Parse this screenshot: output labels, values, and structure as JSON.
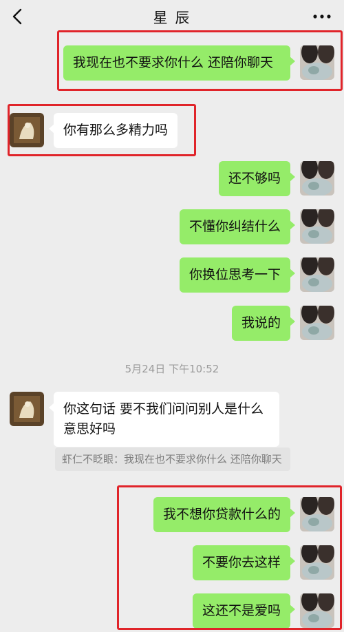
{
  "header": {
    "title": "星 辰",
    "back_icon": "chevron-left-icon",
    "more_icon": "more-dots-icon"
  },
  "messages": [
    {
      "side": "me",
      "text": "我现在也不要求你什么 还陪你聊天"
    },
    {
      "side": "other",
      "text": "你有那么多精力吗"
    },
    {
      "side": "me",
      "text": "还不够吗"
    },
    {
      "side": "me",
      "text": "不懂你纠结什么"
    },
    {
      "side": "me",
      "text": "你换位思考一下"
    },
    {
      "side": "me",
      "text": "我说的"
    },
    {
      "side": "other",
      "text": "你这句话 要不我们问问别人是什么意思好吗"
    },
    {
      "side": "me",
      "text": "我不想你贷款什么的"
    },
    {
      "side": "me",
      "text": "不要你去这样"
    },
    {
      "side": "me",
      "text": "这还不是爱吗"
    }
  ],
  "timestamp": "5月24日 下午10:52",
  "quote": "虾仁不眨眼：我现在也不要求你什么 还陪你聊天",
  "colors": {
    "background": "#ededed",
    "my_bubble": "#95ec69",
    "other_bubble": "#ffffff",
    "highlight_box": "#e0242a"
  }
}
